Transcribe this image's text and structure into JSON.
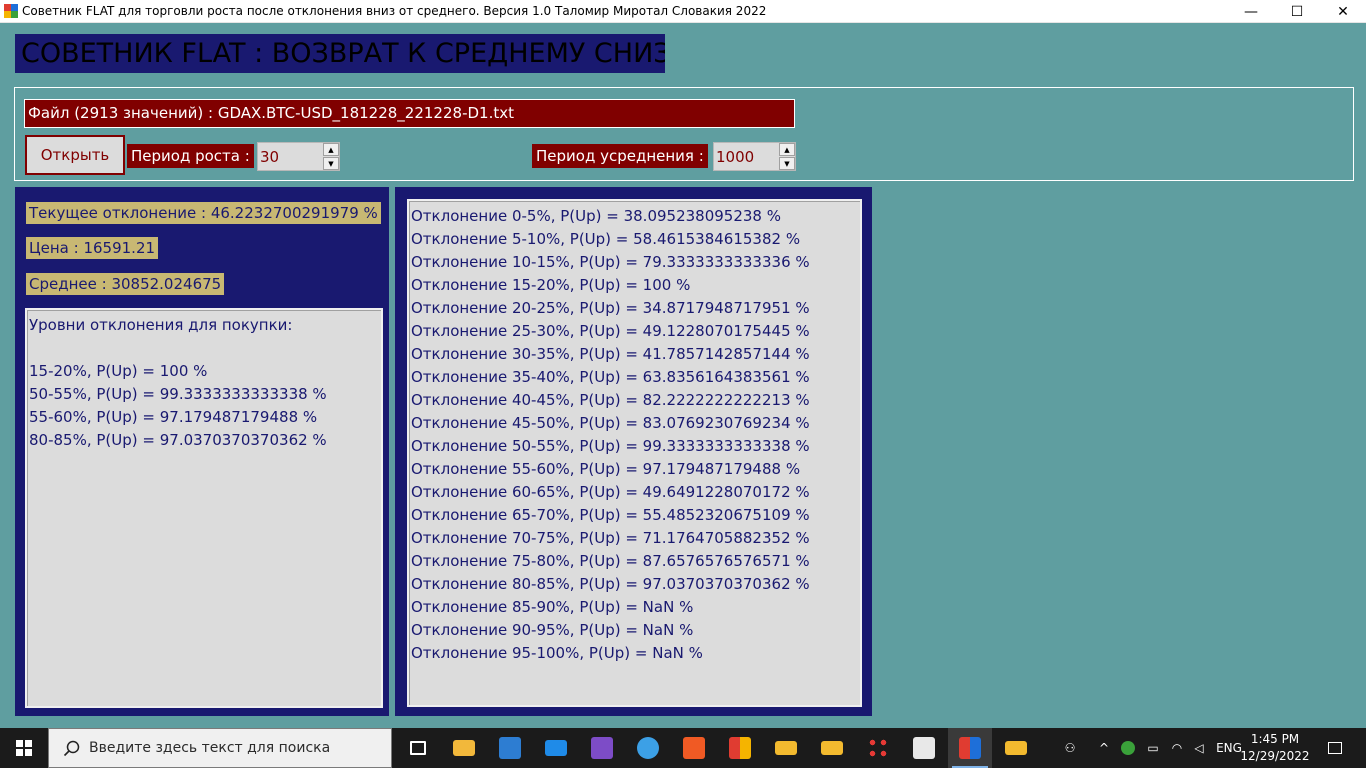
{
  "window": {
    "title": "Советник FLAT для торговли роста после отклонения вниз от среднего. Версия 1.0 Таломир Миротал Словакия 2022",
    "controls": {
      "minimize": "—",
      "maximize": "☐",
      "close": "✕"
    }
  },
  "header": {
    "title": "СОВЕТНИК FLAT : ВОЗВРАТ К СРЕДНЕМУ СНИЗУ"
  },
  "file": {
    "label": "Файл (2913 значений) : GDAX.BTC-USD_181228_221228-D1.txt",
    "open_button": "Открыть"
  },
  "params": {
    "growth_period_label": "Период роста :",
    "growth_period_value": "30",
    "avg_period_label": "Период усреднения :",
    "avg_period_value": "1000"
  },
  "stats": {
    "current_deviation": "Текущее отклонение : 46.2232700291979 %",
    "price": "Цена : 16591.21",
    "average": "Среднее : 30852.024675"
  },
  "buy_levels": {
    "heading": "Уровни отклонения для покупки:",
    "items": [
      "15-20%, P(Up) = 100 %",
      "50-55%, P(Up) = 99.3333333333338 %",
      "55-60%, P(Up) = 97.179487179488 %",
      "80-85%, P(Up) = 97.0370370370362 %"
    ]
  },
  "deviations": [
    "Отклонение 0-5%, P(Up) = 38.095238095238 %",
    "Отклонение 5-10%, P(Up) = 58.4615384615382 %",
    "Отклонение 10-15%, P(Up) = 79.3333333333336 %",
    "Отклонение 15-20%, P(Up) = 100 %",
    "Отклонение 20-25%, P(Up) = 34.8717948717951 %",
    "Отклонение 25-30%, P(Up) = 49.1228070175445 %",
    "Отклонение 30-35%, P(Up) = 41.7857142857144 %",
    "Отклонение 35-40%, P(Up) = 63.8356164383561 %",
    "Отклонение 40-45%, P(Up) = 82.2222222222213 %",
    "Отклонение 45-50%, P(Up) = 83.0769230769234 %",
    "Отклонение 50-55%, P(Up) = 99.3333333333338 %",
    "Отклонение 55-60%, P(Up) = 97.179487179488 %",
    "Отклонение 60-65%, P(Up) = 49.6491228070172 %",
    "Отклонение 65-70%, P(Up) = 55.4852320675109 %",
    "Отклонение 70-75%, P(Up) = 71.1764705882352 %",
    "Отклонение 75-80%, P(Up) = 87.6576576576571 %",
    "Отклонение 80-85%, P(Up) = 97.0370370370362 %",
    "Отклонение 85-90%, P(Up) = NaN %",
    "Отклонение 90-95%, P(Up) = NaN %",
    "Отклонение 95-100%, P(Up) = NaN %"
  ],
  "taskbar": {
    "search_placeholder": "Введите здесь текст для поиска",
    "language": "ENG",
    "time": "1:45 PM",
    "date": "12/29/2022",
    "apps": [
      "task-view",
      "file-explorer",
      "store",
      "mail",
      "visual-studio",
      "edge",
      "brave",
      "app-window",
      "binance-1",
      "binance-2",
      "grid-app",
      "document-viewer",
      "flat-advisor",
      "binance-3"
    ]
  },
  "colors": {
    "background": "#5f9ea0",
    "navy": "#191970",
    "maroon": "#800000",
    "khaki": "#c8b873",
    "listbox": "#dcdcdc"
  }
}
